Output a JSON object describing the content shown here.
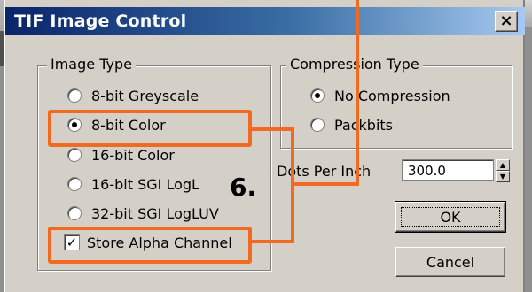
{
  "dialog": {
    "title": "TIF Image Control",
    "close_glyph": "×"
  },
  "image_type": {
    "label": "Image Type",
    "options": [
      {
        "label": "8-bit Greyscale",
        "selected": false
      },
      {
        "label": "8-bit Color",
        "selected": true
      },
      {
        "label": "16-bit Color",
        "selected": false
      },
      {
        "label": "16-bit SGI LogL",
        "selected": false
      },
      {
        "label": "32-bit SGI LogLUV",
        "selected": false
      }
    ],
    "store_alpha": {
      "label": "Store Alpha Channel",
      "checked": true,
      "check_glyph": "✓"
    }
  },
  "compression": {
    "label": "Compression Type",
    "options": [
      {
        "label": "No Compression",
        "selected": true
      },
      {
        "label": "Packbits",
        "selected": false
      }
    ]
  },
  "dpi": {
    "label": "Dots Per Inch",
    "value": "300.0",
    "up_glyph": "▲",
    "down_glyph": "▼"
  },
  "buttons": {
    "ok": "OK",
    "cancel": "Cancel"
  },
  "annotation": {
    "step_number": "6.",
    "color": "#f06a22"
  }
}
